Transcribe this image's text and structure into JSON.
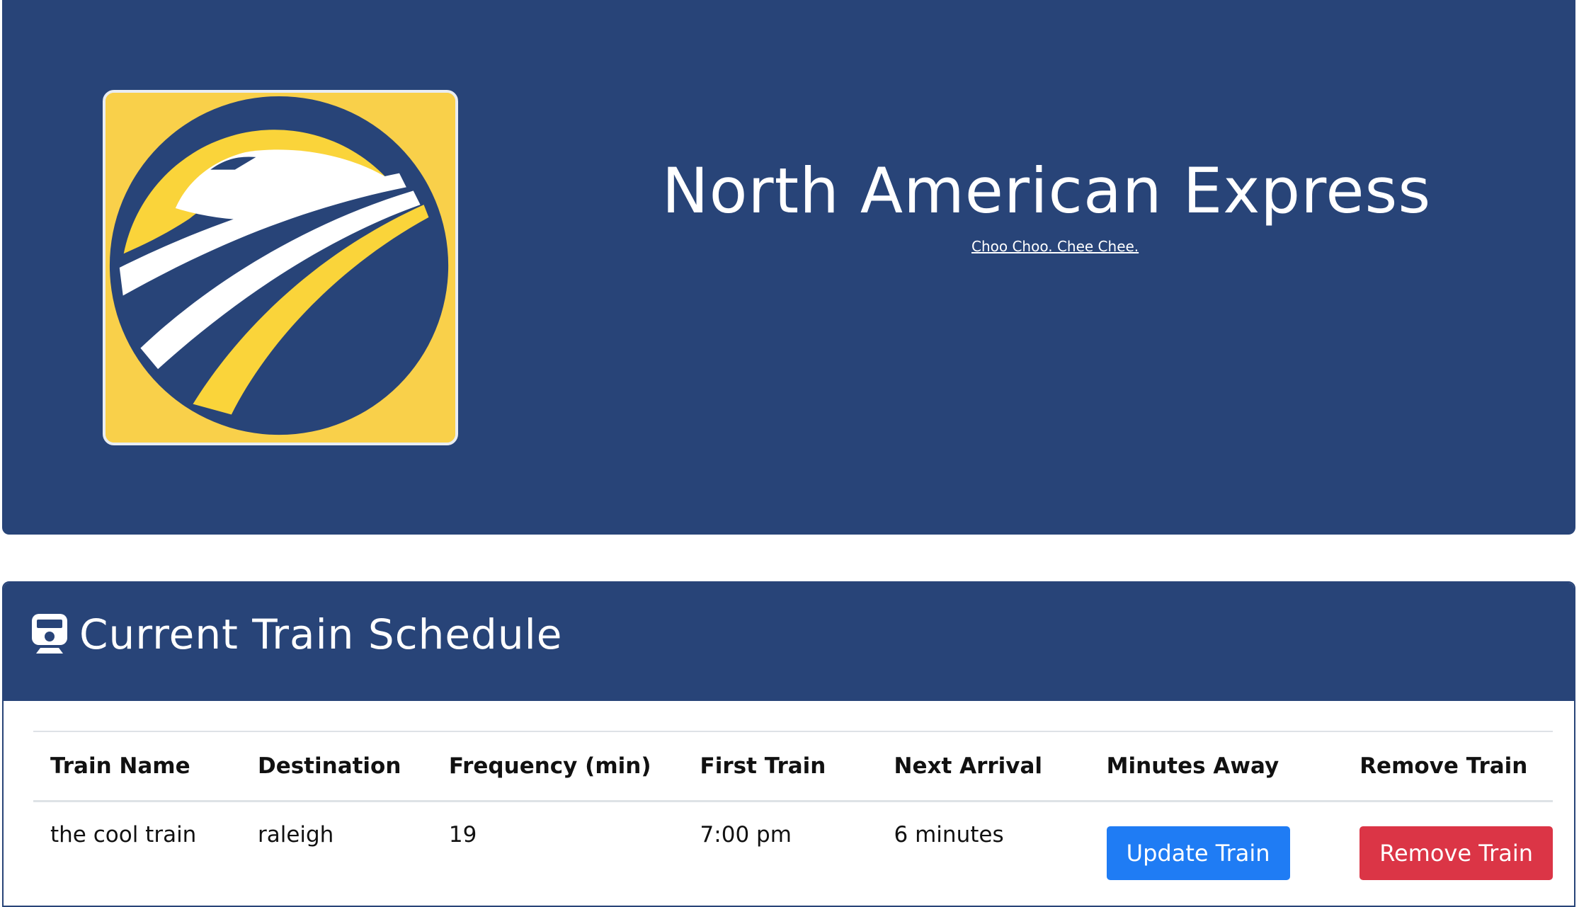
{
  "header": {
    "title": "North American Express",
    "tagline": "Choo Choo. Chee Chee."
  },
  "schedule": {
    "title": "Current Train Schedule",
    "icon": "train-icon",
    "columns": [
      "Train Name",
      "Destination",
      "Frequency (min)",
      "First Train",
      "Next Arrival",
      "Minutes Away",
      "Remove Train"
    ],
    "rows": [
      {
        "name": "the cool train",
        "destination": "raleigh",
        "frequency": "19",
        "first_train": "7:00 pm",
        "next_arrival": "6 minutes",
        "update_label": "Update Train",
        "remove_label": "Remove Train"
      }
    ]
  },
  "colors": {
    "brand_navy": "#284478",
    "logo_yellow": "#f9d04a",
    "update_button": "#1f7cf4",
    "remove_button": "#db3546"
  }
}
